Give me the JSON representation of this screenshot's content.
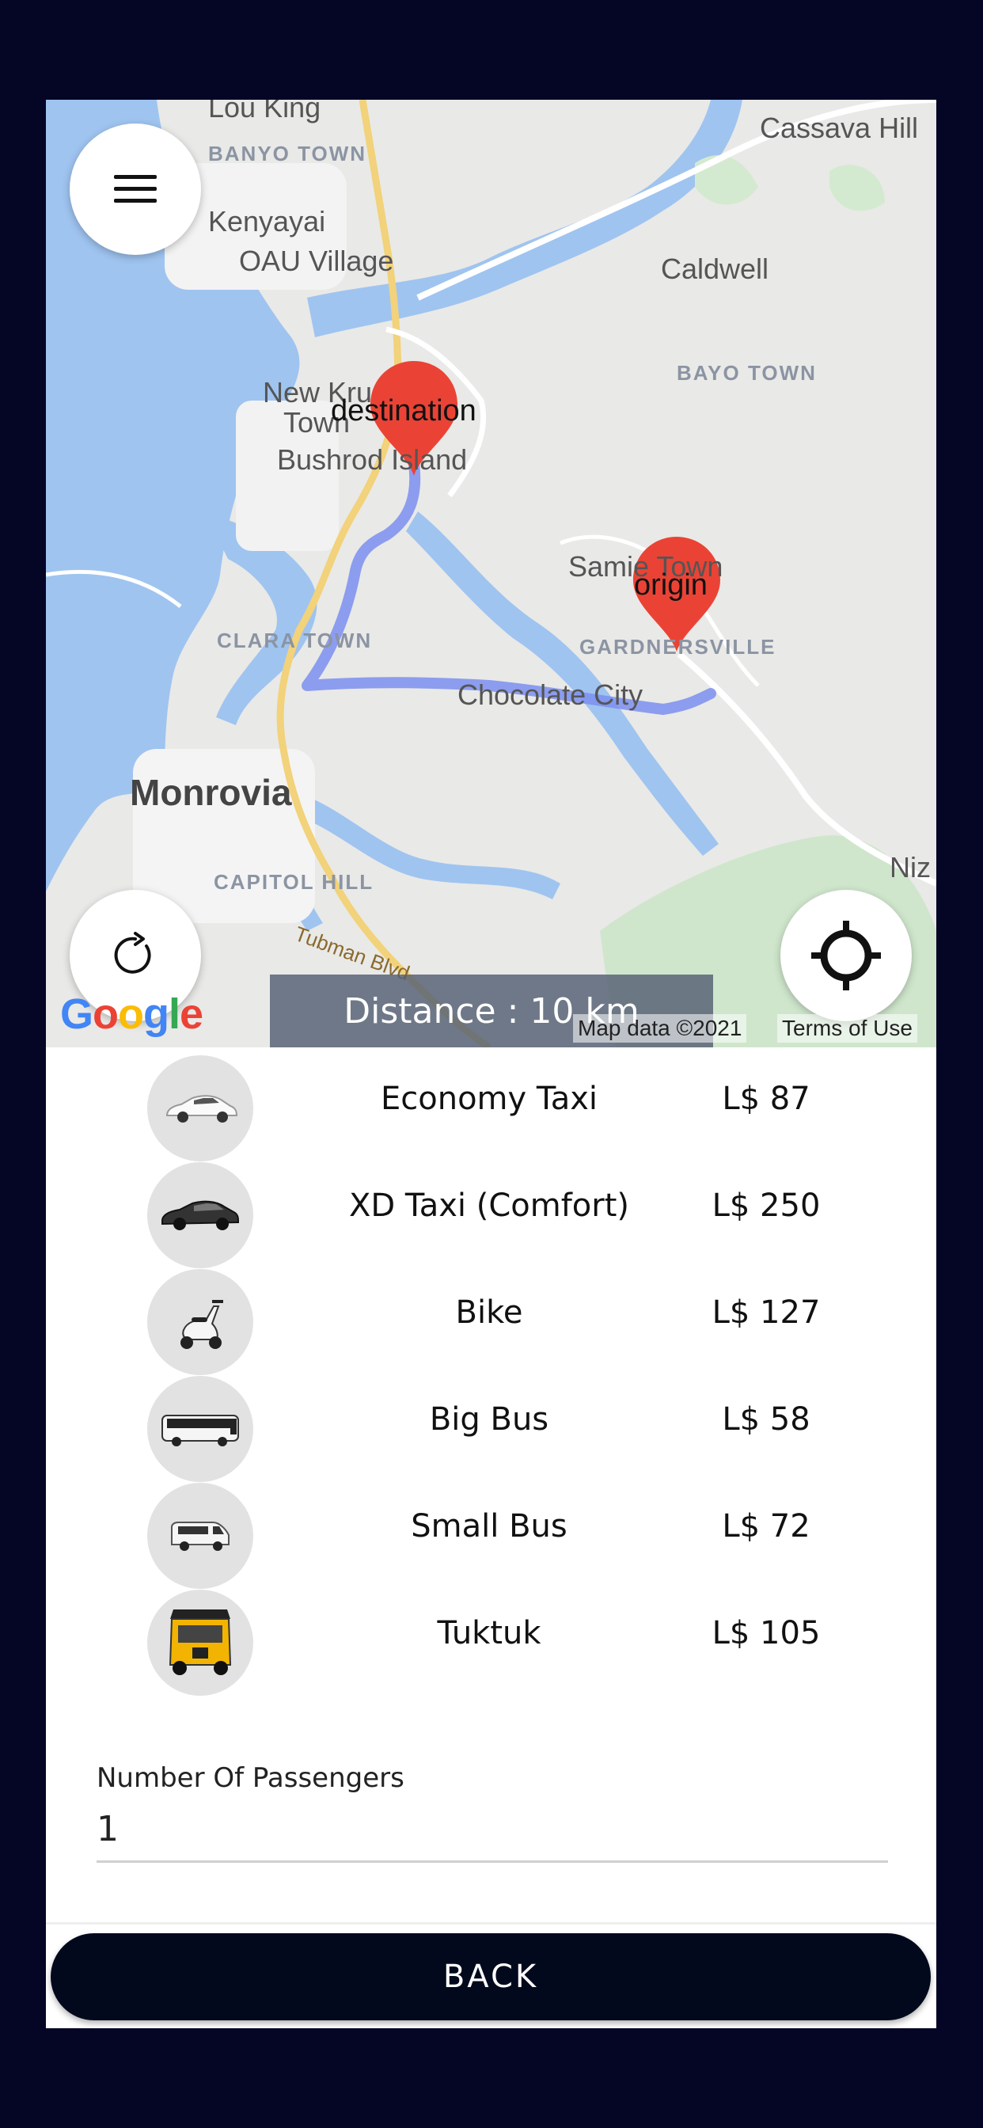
{
  "map": {
    "places": {
      "lou_king": "Lou King",
      "banyo_town": "BANYO TOWN",
      "cassava_hill": "Cassava Hill",
      "kenyayai": "Kenyayai",
      "oau_village": "OAU Village",
      "caldwell": "Caldwell",
      "bayo_town": "BAYO TOWN",
      "new_kru_town_1": "New Kru",
      "new_kru_town_2": "Town",
      "bushrod_island": "Bushrod Island",
      "samie_town": "Samie Town",
      "clara_town": "CLARA TOWN",
      "gardnersville": "GARDNERSVILLE",
      "chocolate_city": "Chocolate City",
      "monrovia": "Monrovia",
      "capitol_hill": "CAPITOL HILL",
      "tubman_blvd": "Tubman Blvd",
      "niz": "Niz"
    },
    "destination_label": "destination",
    "origin_label": "origin",
    "distance_text": "Distance : 10 km",
    "google_logo": "Google",
    "map_data": "Map data ©2021",
    "terms": "Terms of Use",
    "colors": {
      "water": "#9fc4f0",
      "land": "#e9e9e7",
      "route": "#7b8ff0",
      "marker": "#ea4335"
    }
  },
  "buttons": {
    "menu_icon": "hamburger-icon",
    "refresh_icon": "refresh-icon",
    "locate_icon": "crosshair-icon"
  },
  "vehicles": [
    {
      "name": "Economy Taxi",
      "price": "L$ 87",
      "icon": "white-car"
    },
    {
      "name": "XD Taxi (Comfort)",
      "price": "L$ 250",
      "icon": "dark-car"
    },
    {
      "name": "Bike",
      "price": "L$ 127",
      "icon": "scooter"
    },
    {
      "name": "Big Bus",
      "price": "L$ 58",
      "icon": "coach-bus"
    },
    {
      "name": "Small Bus",
      "price": "L$ 72",
      "icon": "minivan"
    },
    {
      "name": "Tuktuk",
      "price": "L$ 105",
      "icon": "tuktuk"
    }
  ],
  "passengers": {
    "label": "Number Of Passengers",
    "value": "1"
  },
  "back_label": "BACK"
}
